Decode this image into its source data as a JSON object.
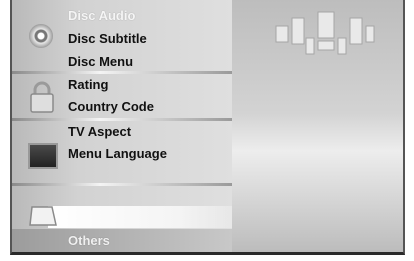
{
  "menu": {
    "items": [
      {
        "label": "Disc Audio"
      },
      {
        "label": "Disc Subtitle"
      },
      {
        "label": "Disc Menu"
      },
      {
        "label": "Rating"
      },
      {
        "label": "Country Code"
      },
      {
        "label": "TV Aspect"
      },
      {
        "label": "Menu Language"
      },
      {
        "label": "Others"
      }
    ]
  },
  "icons": {
    "disc": "disc-icon",
    "lock": "lock-icon",
    "tv": "tv-icon",
    "others": "others-icon",
    "speakers": "speaker-layout-icon"
  }
}
